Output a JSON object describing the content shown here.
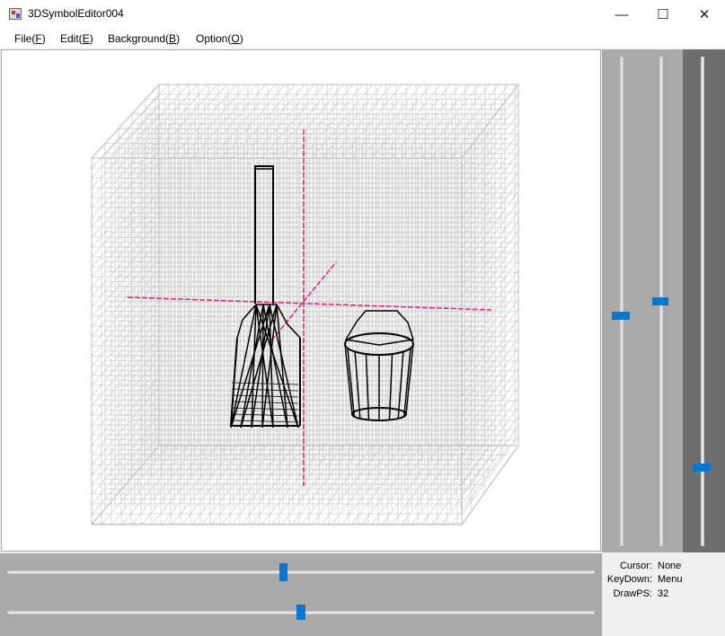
{
  "window": {
    "title": "3DSymbolEditor004"
  },
  "menu": [
    {
      "label": "File(",
      "key": "F",
      "close": ")"
    },
    {
      "label": "Edit(",
      "key": "E",
      "close": ")"
    },
    {
      "label": "Background(",
      "key": "B",
      "close": ")"
    },
    {
      "label": "Option(",
      "key": "O",
      "close": ")"
    }
  ],
  "window_buttons": {
    "minimize": "—",
    "maximize": "☐",
    "close": "✕"
  },
  "status": {
    "cursor_label": "Cursor:",
    "cursor_value": "None",
    "keydown_label": "KeyDown:",
    "keydown_value": "Menu",
    "drawps_label": "DrawPS:",
    "drawps_value": "32"
  },
  "colors": {
    "accent": "#0078d7",
    "grid": "#d0d0d0",
    "axis": "#e0207a",
    "wire": "#000000",
    "panel": "#a9a9a9"
  },
  "sliders": {
    "right_vertical_1": 0.53,
    "right_vertical_2": 0.5,
    "right_vertical_3": 0.84,
    "bottom_horizontal_1": 0.47,
    "bottom_horizontal_2": 0.5
  }
}
